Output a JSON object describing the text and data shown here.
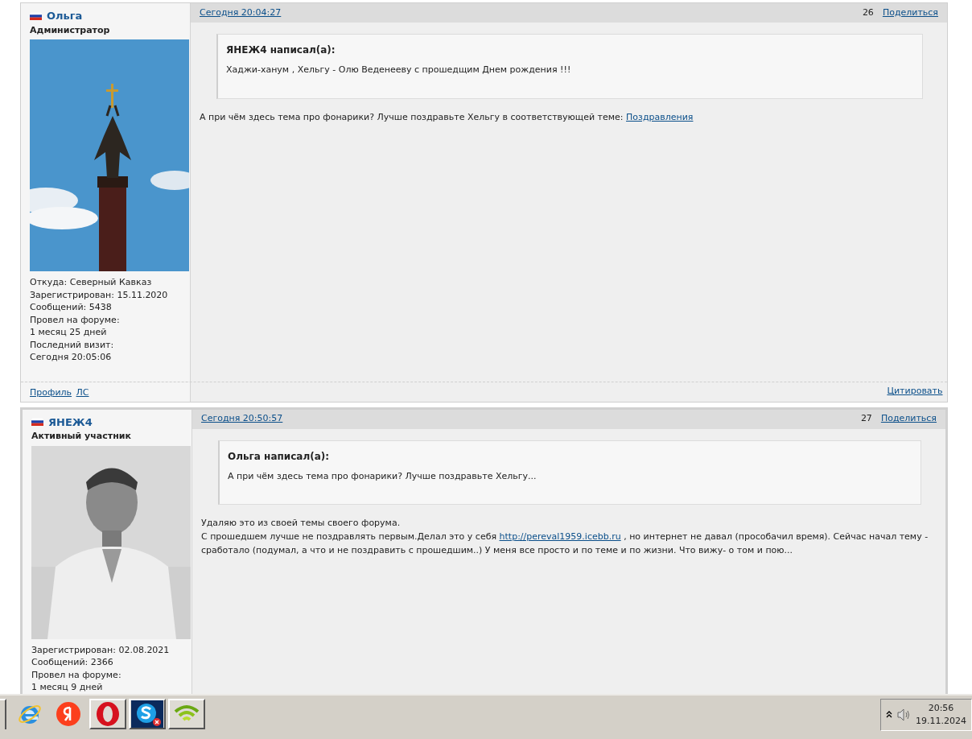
{
  "posts": [
    {
      "author": {
        "name": "Ольга",
        "role": "Администратор"
      },
      "info": [
        "Откуда: Северный Кавказ",
        "Зарегистрирован: 15.11.2020",
        "Сообщений: 5438",
        "Провел на форуме:",
        "1 месяц 25 дней",
        "Последний визит:",
        "Сегодня 20:05:06"
      ],
      "date": "Сегодня 20:04:27",
      "number": "26",
      "share": "Поделиться",
      "quote": {
        "header": "ЯНЕЖ4 написал(а):",
        "text": "Хаджи-ханум , Хельгу - Олю Веденееву с прошедщим Днем рождения  !!!"
      },
      "message": [
        [
          {
            "kind": "text",
            "text": "А при чём здесь тема про фонарики? Лучше поздравьте Хельгу в соответствующей теме: "
          },
          {
            "kind": "link",
            "text": "Поздравления"
          }
        ]
      ],
      "footer": {
        "links": [
          "Профиль",
          "ЛС"
        ],
        "quote_button": "Цитировать"
      }
    },
    {
      "author": {
        "name": "ЯНЕЖ4",
        "role": "Активный участник"
      },
      "info": [
        "Зарегистрирован: 02.08.2021",
        "Сообщений: 2366",
        "Провел на форуме:",
        "1 месяц 9 дней"
      ],
      "date": "Сегодня 20:50:57",
      "number": "27",
      "share": "Поделиться",
      "quote": {
        "header": "Ольга написал(а):",
        "text": "А при чём здесь тема про фонарики? Лучше поздравьте Хельгу..."
      },
      "message": [
        [
          {
            "kind": "text",
            "text": "Удаляю это из своей темы своего форума."
          }
        ],
        [
          {
            "kind": "text",
            "text": "С прошедшем лучше не поздравлять первым.Делал это у себя "
          },
          {
            "kind": "link",
            "text": "http://pereval1959.icebb.ru"
          },
          {
            "kind": "text",
            "text": " , но интернет не давал (прособачил время). Сейчас начал тему - сработало (подумал, а что и не поздравить с прошедшим..) У меня все просто и по теме и по жизни. Что вижу- о том и пою..."
          }
        ]
      ]
    }
  ],
  "taskbar": {
    "apps": [
      {
        "kind": "ie",
        "running": false
      },
      {
        "kind": "yandex",
        "running": false
      },
      {
        "kind": "opera",
        "running": true
      },
      {
        "kind": "skype",
        "running": true
      },
      {
        "kind": "wifi",
        "running": true
      }
    ],
    "clock": {
      "time": "20:56",
      "date": "19.11.2024"
    }
  }
}
